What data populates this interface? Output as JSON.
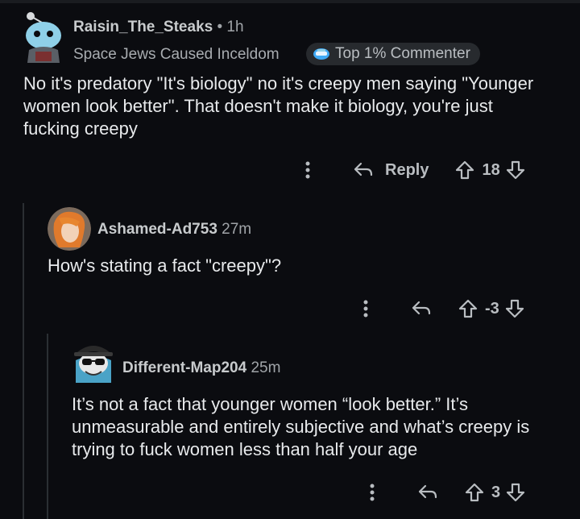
{
  "comments": [
    {
      "username": "Raisin_The_Steaks",
      "time": "• 1h",
      "flair": "Space Jews Caused Inceldom",
      "badge": "Top 1% Commenter",
      "body": "No it's predatory \"It's biology\" no it's creepy men saying \"Younger women look better\". That doesn't make it biology, you're just fucking creepy",
      "reply_label": "Reply",
      "score": "18"
    },
    {
      "username": "Ashamed-Ad753",
      "time": "27m",
      "body": "How's stating a fact \"creepy\"?",
      "score": "-3"
    },
    {
      "username": "Different-Map204",
      "time": "25m",
      "body": "It’s not a fact that younger women “look better.” It’s unmeasurable and entirely subjective and what’s creepy is trying to fuck women less than half your age",
      "score": "3"
    }
  ],
  "colors": {
    "background": "#0b0c10",
    "text": "#e8eaec",
    "muted": "#a0a4a8",
    "thread_line": "#2b2f33"
  }
}
